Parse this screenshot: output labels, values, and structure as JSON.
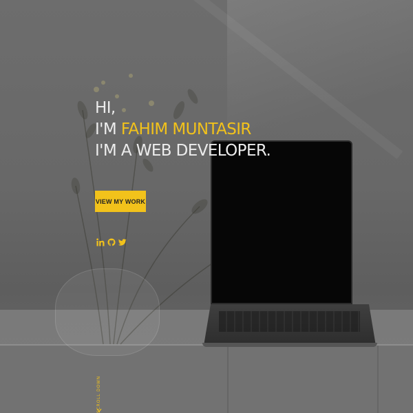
{
  "hero": {
    "greeting": "HI,",
    "intro_prefix": "I'M",
    "name": "FAHIM MUNTASIR",
    "role": "I'M A WEB DEVELOPER."
  },
  "cta": {
    "label": "VIEW MY WORK"
  },
  "social": [
    {
      "name": "linkedin-icon",
      "glyph": "in"
    },
    {
      "name": "github-icon"
    },
    {
      "name": "twitter-icon"
    }
  ],
  "scroll": {
    "label": "SCROLL DOWN"
  },
  "colors": {
    "accent": "#f2c21b",
    "text": "#ececec",
    "overlay": "#6a6a6a",
    "button_text": "#222222"
  }
}
